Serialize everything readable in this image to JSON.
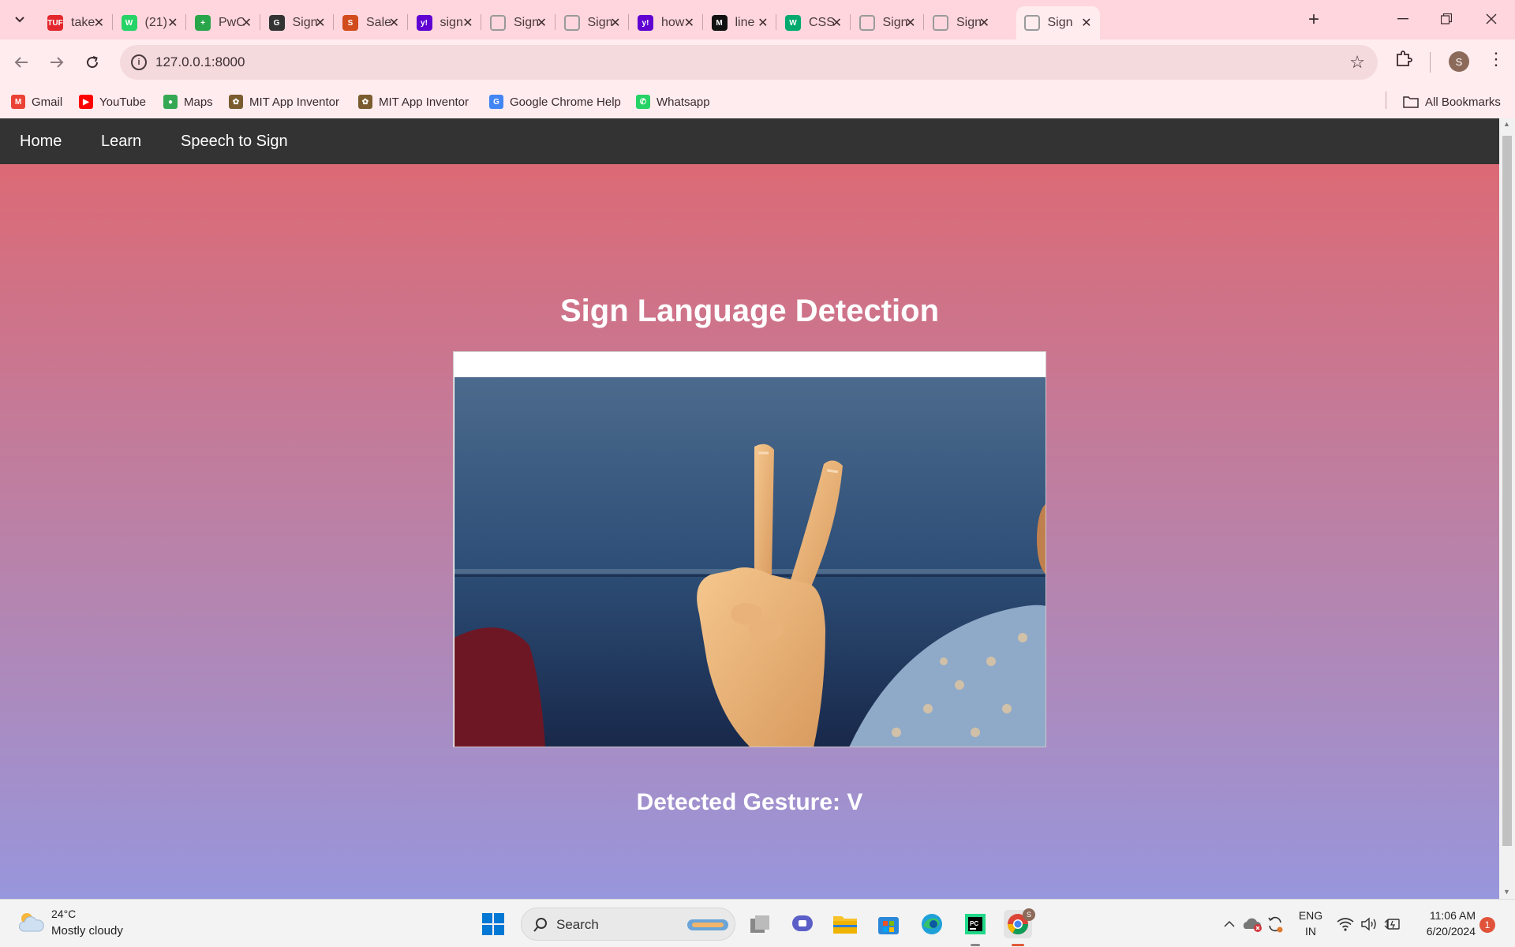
{
  "browser": {
    "tabs": [
      {
        "title": "take",
        "favicon_color": "#e3262d",
        "favicon_label": "TUF"
      },
      {
        "title": "(21)",
        "favicon_color": "#25d366",
        "favicon_label": "W"
      },
      {
        "title": "PwC",
        "favicon_color": "#2aa64a",
        "favicon_label": "+"
      },
      {
        "title": "Sign",
        "favicon_color": "#333333",
        "favicon_label": "G"
      },
      {
        "title": "Sale",
        "favicon_color": "#d14b1c",
        "favicon_label": "S"
      },
      {
        "title": "sign",
        "favicon_color": "#6001d2",
        "favicon_label": "y!"
      },
      {
        "title": "Sign",
        "favicon_color": "#9a9a9a",
        "favicon_label": ""
      },
      {
        "title": "Sign",
        "favicon_color": "#9a9a9a",
        "favicon_label": ""
      },
      {
        "title": "how",
        "favicon_color": "#6001d2",
        "favicon_label": "y!"
      },
      {
        "title": "line",
        "favicon_color": "#111111",
        "favicon_label": "M"
      },
      {
        "title": "CSS",
        "favicon_color": "#04aa6d",
        "favicon_label": "W"
      },
      {
        "title": "Sign",
        "favicon_color": "#9a9a9a",
        "favicon_label": ""
      },
      {
        "title": "Sign",
        "favicon_color": "#9a9a9a",
        "favicon_label": ""
      },
      {
        "title": "Sign",
        "favicon_color": "#9a9a9a",
        "favicon_label": ""
      }
    ],
    "url": "127.0.0.1:8000",
    "bookmarks": [
      {
        "label": "Gmail",
        "icon": "gmail-icon",
        "color": "#ea4335"
      },
      {
        "label": "YouTube",
        "icon": "youtube-icon",
        "color": "#ff0000"
      },
      {
        "label": "Maps",
        "icon": "maps-icon",
        "color": "#34a853"
      },
      {
        "label": "MIT App Inventor",
        "icon": "mit-icon",
        "color": "#7a5c2e"
      },
      {
        "label": "MIT App Inventor",
        "icon": "mit-icon",
        "color": "#7a5c2e"
      },
      {
        "label": "Google Chrome Help",
        "icon": "google-icon",
        "color": "#4285f4"
      },
      {
        "label": "Whatsapp",
        "icon": "whatsapp-icon",
        "color": "#25d366"
      }
    ],
    "all_bookmarks": "All Bookmarks",
    "profile_initial": "S"
  },
  "page": {
    "nav": [
      "Home",
      "Learn",
      "Speech to Sign"
    ],
    "title": "Sign Language Detection",
    "gesture_text": "Detected Gesture: V"
  },
  "taskbar": {
    "weather_temp": "24°C",
    "weather_desc": "Mostly cloudy",
    "search_label": "Search",
    "lang_line1": "ENG",
    "lang_line2": "IN",
    "time": "11:06 AM",
    "date": "6/20/2024",
    "notification_count": "1",
    "chrome_badge": "S"
  }
}
